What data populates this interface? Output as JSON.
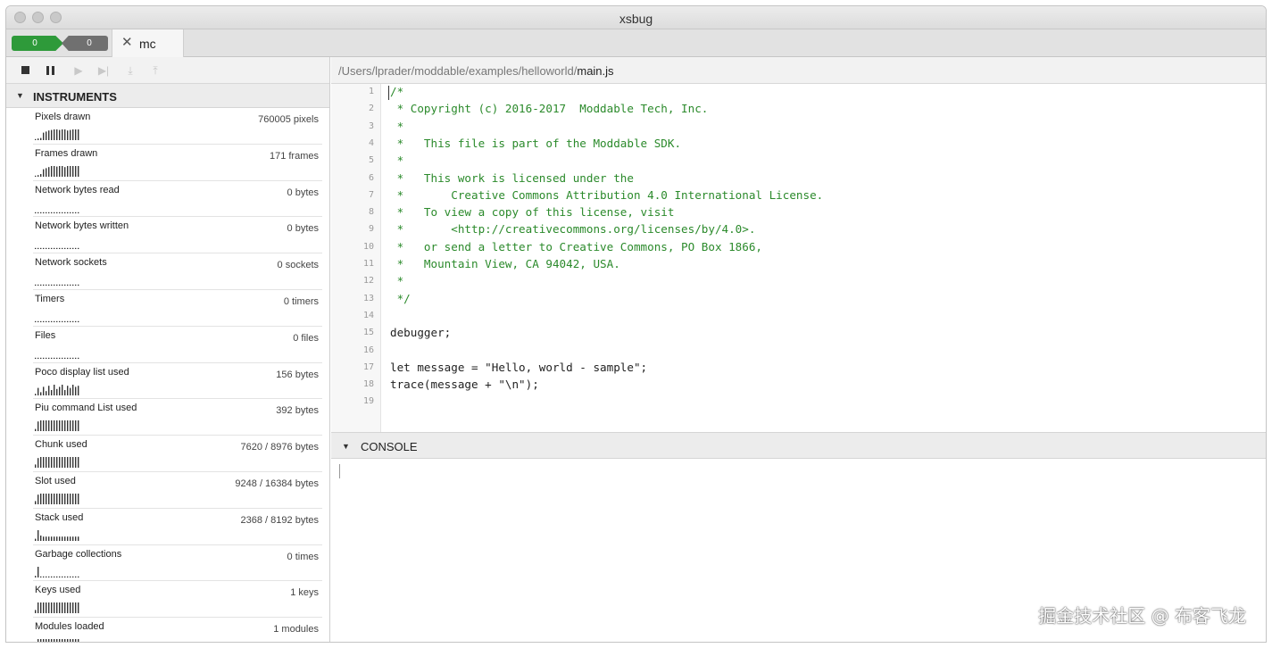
{
  "window": {
    "title": "xsbug"
  },
  "tabs": {
    "green_badge": "0",
    "gray_badge": "0",
    "machine_tab": {
      "label": "mc"
    }
  },
  "toolbar": {
    "icons": [
      "stop-icon",
      "pause-icon",
      "run-icon",
      "step-icon",
      "step-in-icon",
      "step-out-icon"
    ]
  },
  "instruments": {
    "header": "INSTRUMENTS",
    "items": [
      {
        "label": "Pixels drawn",
        "value": "760005 pixels",
        "bars": [
          0.1,
          0.15,
          0.2,
          0.7,
          0.8,
          0.9,
          0.95,
          1,
          1,
          0.95,
          1,
          1,
          0.9,
          0.95,
          1,
          1,
          1
        ]
      },
      {
        "label": "Frames drawn",
        "value": "171 frames",
        "bars": [
          0.1,
          0.15,
          0.25,
          0.7,
          0.8,
          0.9,
          1,
          1,
          0.95,
          1,
          1,
          0.9,
          1,
          1,
          1,
          1,
          1
        ]
      },
      {
        "label": "Network bytes read",
        "value": "0 bytes",
        "bars": [
          0.1,
          0.1,
          0.1,
          0.1,
          0.1,
          0.1,
          0.1,
          0.1,
          0.1,
          0.1,
          0.1,
          0.1,
          0.1,
          0.1,
          0.1,
          0.1,
          0.1
        ]
      },
      {
        "label": "Network bytes written",
        "value": "0 bytes",
        "bars": [
          0.1,
          0.1,
          0.1,
          0.1,
          0.1,
          0.1,
          0.1,
          0.1,
          0.1,
          0.1,
          0.1,
          0.1,
          0.1,
          0.1,
          0.1,
          0.1,
          0.1
        ]
      },
      {
        "label": "Network sockets",
        "value": "0 sockets",
        "bars": [
          0.1,
          0.1,
          0.1,
          0.1,
          0.1,
          0.1,
          0.1,
          0.1,
          0.1,
          0.1,
          0.1,
          0.1,
          0.1,
          0.1,
          0.1,
          0.1,
          0.1
        ]
      },
      {
        "label": "Timers",
        "value": "0 timers",
        "bars": [
          0.1,
          0.1,
          0.1,
          0.1,
          0.1,
          0.1,
          0.1,
          0.1,
          0.1,
          0.1,
          0.1,
          0.1,
          0.1,
          0.1,
          0.1,
          0.1,
          0.1
        ]
      },
      {
        "label": "Files",
        "value": "0 files",
        "bars": [
          0.1,
          0.1,
          0.1,
          0.1,
          0.1,
          0.1,
          0.1,
          0.1,
          0.1,
          0.1,
          0.1,
          0.1,
          0.1,
          0.1,
          0.1,
          0.1,
          0.1
        ]
      },
      {
        "label": "Poco display list used",
        "value": "156 bytes",
        "bars": [
          0.15,
          0.7,
          0.3,
          0.8,
          0.4,
          0.9,
          0.5,
          1,
          0.6,
          0.8,
          1,
          0.5,
          0.9,
          0.7,
          1,
          0.8,
          0.9
        ]
      },
      {
        "label": "Piu command List used",
        "value": "392 bytes",
        "bars": [
          0.2,
          0.9,
          1,
          1,
          1,
          1,
          1,
          1,
          1,
          1,
          1,
          1,
          1,
          1,
          1,
          1,
          1
        ]
      },
      {
        "label": "Chunk used",
        "value": "7620 / 8976 bytes",
        "bars": [
          0.3,
          0.9,
          1,
          1,
          1,
          1,
          1,
          1,
          1,
          1,
          1,
          1,
          1,
          1,
          1,
          1,
          1
        ]
      },
      {
        "label": "Slot used",
        "value": "9248 / 16384 bytes",
        "bars": [
          0.3,
          0.9,
          1,
          1,
          1,
          1,
          1,
          1,
          1,
          1,
          1,
          1,
          1,
          1,
          1,
          1,
          1
        ]
      },
      {
        "label": "Stack used",
        "value": "2368 / 8192 bytes",
        "bars": [
          0.2,
          1,
          0.5,
          0.4,
          0.4,
          0.4,
          0.4,
          0.4,
          0.4,
          0.4,
          0.4,
          0.4,
          0.4,
          0.4,
          0.4,
          0.4,
          0.4
        ]
      },
      {
        "label": "Garbage collections",
        "value": "0 times",
        "bars": [
          0.15,
          1,
          0.1,
          0.1,
          0.1,
          0.1,
          0.1,
          0.1,
          0.1,
          0.1,
          0.1,
          0.1,
          0.1,
          0.1,
          0.1,
          0.1,
          0.1
        ]
      },
      {
        "label": "Keys used",
        "value": "1 keys",
        "bars": [
          0.3,
          1,
          1,
          1,
          1,
          1,
          1,
          1,
          1,
          1,
          1,
          1,
          1,
          1,
          1,
          1,
          1
        ]
      },
      {
        "label": "Modules loaded",
        "value": "1 modules",
        "bars": [
          0.3,
          1,
          1,
          1,
          1,
          1,
          1,
          1,
          1,
          1,
          1,
          1,
          1,
          1,
          1,
          1,
          1
        ]
      }
    ]
  },
  "editor": {
    "path_dir": "/Users/lprader/moddable/examples/helloworld/",
    "path_file": "main.js",
    "lines": [
      {
        "n": "1",
        "text": "/*",
        "kind": "comment"
      },
      {
        "n": "2",
        "text": " * Copyright (c) 2016-2017  Moddable Tech, Inc.",
        "kind": "comment"
      },
      {
        "n": "3",
        "text": " *",
        "kind": "comment"
      },
      {
        "n": "4",
        "text": " *   This file is part of the Moddable SDK.",
        "kind": "comment"
      },
      {
        "n": "5",
        "text": " *",
        "kind": "comment"
      },
      {
        "n": "6",
        "text": " *   This work is licensed under the",
        "kind": "comment"
      },
      {
        "n": "7",
        "text": " *       Creative Commons Attribution 4.0 International License.",
        "kind": "comment"
      },
      {
        "n": "8",
        "text": " *   To view a copy of this license, visit",
        "kind": "comment"
      },
      {
        "n": "9",
        "text": " *       <http://creativecommons.org/licenses/by/4.0>.",
        "kind": "comment"
      },
      {
        "n": "10",
        "text": " *   or send a letter to Creative Commons, PO Box 1866,",
        "kind": "comment"
      },
      {
        "n": "11",
        "text": " *   Mountain View, CA 94042, USA.",
        "kind": "comment"
      },
      {
        "n": "12",
        "text": " *",
        "kind": "comment"
      },
      {
        "n": "13",
        "text": " */",
        "kind": "comment"
      },
      {
        "n": "14",
        "text": "",
        "kind": "code"
      },
      {
        "n": "15",
        "text": "debugger;",
        "kind": "code"
      },
      {
        "n": "16",
        "text": "",
        "kind": "code"
      },
      {
        "n": "17",
        "text": "let message = \"Hello, world - sample\";",
        "kind": "code"
      },
      {
        "n": "18",
        "text": "trace(message + \"\\n\");",
        "kind": "code"
      },
      {
        "n": "19",
        "text": "",
        "kind": "code"
      }
    ]
  },
  "console": {
    "header": "CONSOLE"
  },
  "watermark": "掘金技术社区 @ 布客飞龙",
  "colors": {
    "comment": "#2b8a2b",
    "badge_green": "#2e9a3a",
    "badge_gray": "#707070"
  }
}
